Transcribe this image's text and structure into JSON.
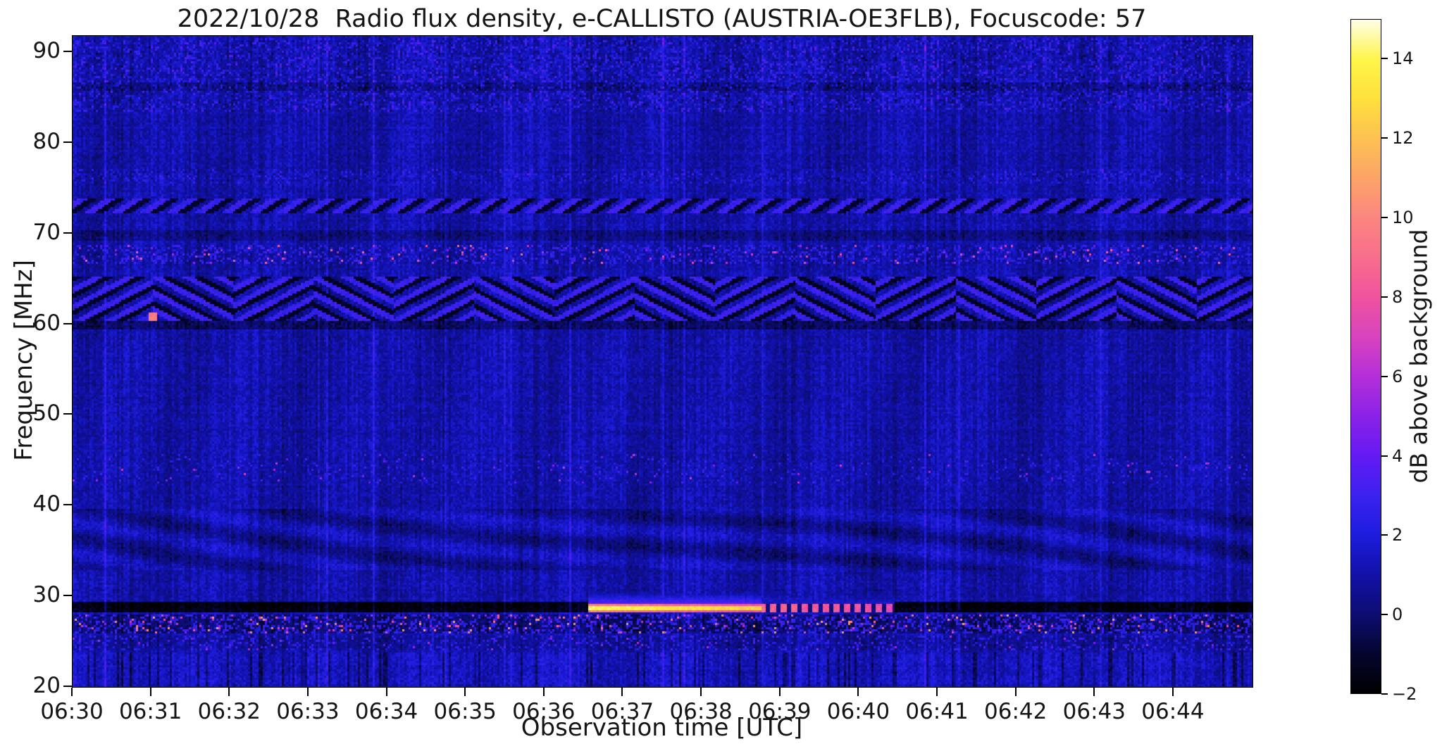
{
  "figure": {
    "title": "2022/10/28  Radio flux density, e-CALLISTO (AUSTRIA-OE3FLB), Focuscode: 57"
  },
  "axes": {
    "xlabel": "Observation time [UTC]",
    "ylabel": "Frequency [MHz]",
    "x_tick_labels": [
      "06:30",
      "06:31",
      "06:32",
      "06:33",
      "06:34",
      "06:35",
      "06:36",
      "06:37",
      "06:38",
      "06:39",
      "06:40",
      "06:41",
      "06:42",
      "06:43",
      "06:44"
    ],
    "y_tick_values": [
      90,
      80,
      70,
      60,
      50,
      40,
      30,
      20
    ],
    "time_start": "06:30",
    "time_end": "06:45",
    "freq_range_mhz": [
      20,
      91.8
    ]
  },
  "colorbar": {
    "label": "dB above background",
    "tick_values": [
      14,
      12,
      10,
      8,
      6,
      4,
      2,
      0,
      -2
    ],
    "tick_labels": [
      "14",
      "12",
      "10",
      "8",
      "6",
      "4",
      "2",
      "0",
      "−2"
    ],
    "range_db": [
      -2,
      15
    ],
    "colormap_stops": [
      {
        "v": -2.0,
        "c": "#000000"
      },
      {
        "v": -1.0,
        "c": "#050530"
      },
      {
        "v": 0.0,
        "c": "#0d0d72"
      },
      {
        "v": 1.0,
        "c": "#1111a8"
      },
      {
        "v": 2.0,
        "c": "#1d1ddd"
      },
      {
        "v": 3.0,
        "c": "#3c22f0"
      },
      {
        "v": 4.0,
        "c": "#641af2"
      },
      {
        "v": 5.0,
        "c": "#8c22e8"
      },
      {
        "v": 6.0,
        "c": "#b42fd8"
      },
      {
        "v": 7.0,
        "c": "#d843bf"
      },
      {
        "v": 8.0,
        "c": "#f0539e"
      },
      {
        "v": 9.0,
        "c": "#f86e8c"
      },
      {
        "v": 10.0,
        "c": "#fb8680"
      },
      {
        "v": 11.0,
        "c": "#fca468"
      },
      {
        "v": 12.0,
        "c": "#fdc152"
      },
      {
        "v": 13.0,
        "c": "#fee03c"
      },
      {
        "v": 14.0,
        "c": "#fff54a"
      },
      {
        "v": 15.0,
        "c": "#fffde8"
      }
    ]
  },
  "chart_data": {
    "type": "heatmap",
    "title": "2022/10/28  Radio flux density, e-CALLISTO (AUSTRIA-OE3FLB), Focuscode: 57",
    "xlabel": "Observation time [UTC]",
    "ylabel": "Frequency [MHz]",
    "x_range": [
      "06:30",
      "06:45"
    ],
    "y_range_mhz": [
      20,
      91.8
    ],
    "value_unit": "dB above background",
    "value_range": [
      -2,
      15
    ],
    "background_level_db": 1.0,
    "description": "Dynamic radio spectrum (spectrogram), dark-blue noise background with vertical striations, horizontal RFI bands and one bright narrowband burst near 28.5 MHz from ~06:36:35 to ~06:40:25.",
    "events": [
      {
        "name": "bright-narrowband-burst",
        "freq_mhz": [
          28.3,
          29.2
        ],
        "time_min_after_0630": [
          6.55,
          10.45
        ],
        "peak_db": 14,
        "note": "solid white-yellow core until ~06:38:45, then dashed pink/orange tail"
      }
    ],
    "features": [
      {
        "type": "speckle_band",
        "fmin": 83.5,
        "fmax": 91.6,
        "density": 0.45,
        "amp": 1.5
      },
      {
        "type": "dark_lane",
        "fmin": 85.7,
        "fmax": 86.6,
        "amp": -0.7
      },
      {
        "type": "speckle_band",
        "fmin": 75.4,
        "fmax": 77.2,
        "density": 0.4,
        "amp": 1.1
      },
      {
        "type": "dash_band",
        "fmin": 72.3,
        "fmax": 73.9,
        "bright": 2.3,
        "dark": -1.5
      },
      {
        "type": "dark_lane",
        "fmin": 69.2,
        "fmax": 70.4,
        "amp": -0.75
      },
      {
        "type": "rfi_speckle",
        "fmin": 66.6,
        "fmax": 68.7,
        "blue_density": 0.22,
        "hot_density": 0.03,
        "hot_min": 4,
        "hot_max": 9,
        "dark_base": -0.15
      },
      {
        "type": "herringbone",
        "fmin": 60.3,
        "fmax": 65.3,
        "bright": 2.3,
        "dark": -1.6
      },
      {
        "type": "dark_lane",
        "fmin": 59.4,
        "fmax": 60.3,
        "amp": -1.3
      },
      {
        "type": "rfi_speckle",
        "fmin": 42.5,
        "fmax": 45.6,
        "blue_density": 0.05,
        "hot_density": 0.01,
        "hot_min": 3.5,
        "hot_max": 7,
        "dark_base": 0
      },
      {
        "type": "waves",
        "fmin": 32.8,
        "fmax": 39.6,
        "amp": 0.7
      },
      {
        "type": "dark_lane",
        "fmin": 28.15,
        "fmax": 29.35,
        "amp": -2.7
      },
      {
        "type": "burst",
        "fmin": 28.3,
        "fmax": 29.2,
        "halo_fmax": 30.5,
        "t_start": 6.55,
        "t_solid": 8.75,
        "t_end": 10.45,
        "v_peak": 14.2,
        "v_end": 7.5
      },
      {
        "type": "rfi_speckle",
        "fmin": 25.8,
        "fmax": 28.1,
        "blue_density": 0.3,
        "hot_density": 0.055,
        "hot_min": 4,
        "hot_max": 11,
        "dark_base": -1.1
      },
      {
        "type": "rfi_speckle",
        "fmin": 24.0,
        "fmax": 25.6,
        "blue_density": 0.14,
        "hot_density": 0.013,
        "hot_min": 3,
        "hot_max": 6,
        "dark_base": -0.3
      },
      {
        "type": "bright_noise",
        "fmin": 20.0,
        "fmax": 23.9,
        "amp": 0.35
      },
      {
        "type": "pink_spot",
        "f": 60.8,
        "t": 1.03,
        "v": 9.0
      }
    ]
  }
}
